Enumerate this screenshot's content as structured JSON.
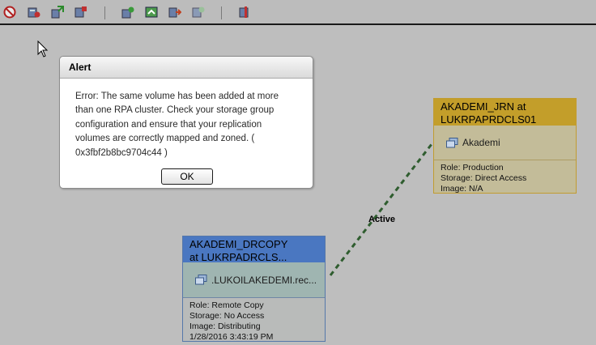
{
  "toolbar": {
    "buttons": [
      "no-entry-icon",
      "add-storage-icon",
      "transfer-icon",
      "remove-storage-icon",
      "refresh-group-icon",
      "image-access-icon",
      "failover-icon",
      "recover-icon",
      "stop-transfer-icon"
    ]
  },
  "alert": {
    "title": "Alert",
    "message_lines": [
      "Error: The same volume has been added at more",
      "than one RPA cluster. Check your storage group",
      "configuration and ensure that your replication",
      "volumes are correctly mapped and zoned. (",
      "0x3fbf2b8bc9704c44 )"
    ],
    "ok_label": "OK"
  },
  "production_copy": {
    "title_line1": "AKADEMI_JRN at",
    "title_line2": "LUKRPAPRDCLS01",
    "volume": "Akademi",
    "role": "Role: Production",
    "storage": "Storage: Direct Access",
    "image": "Image: N/A"
  },
  "remote_copy": {
    "title_line1": "AKADEMI_DRCOPY",
    "title_line2": "at LUKRPADRCLS...",
    "volume": ".LUKOILAKEDEMI.rec...",
    "role": "Role: Remote Copy",
    "storage": "Storage: No Access",
    "image": "Image: Distributing",
    "timestamp": "1/28/2016 3:43:19 PM"
  },
  "link": {
    "label": "Active"
  },
  "colors": {
    "canvas": "#bebebe",
    "production_header": "#c39e2a",
    "remote_header": "#4a77c1",
    "link": "#2f5d2f"
  }
}
